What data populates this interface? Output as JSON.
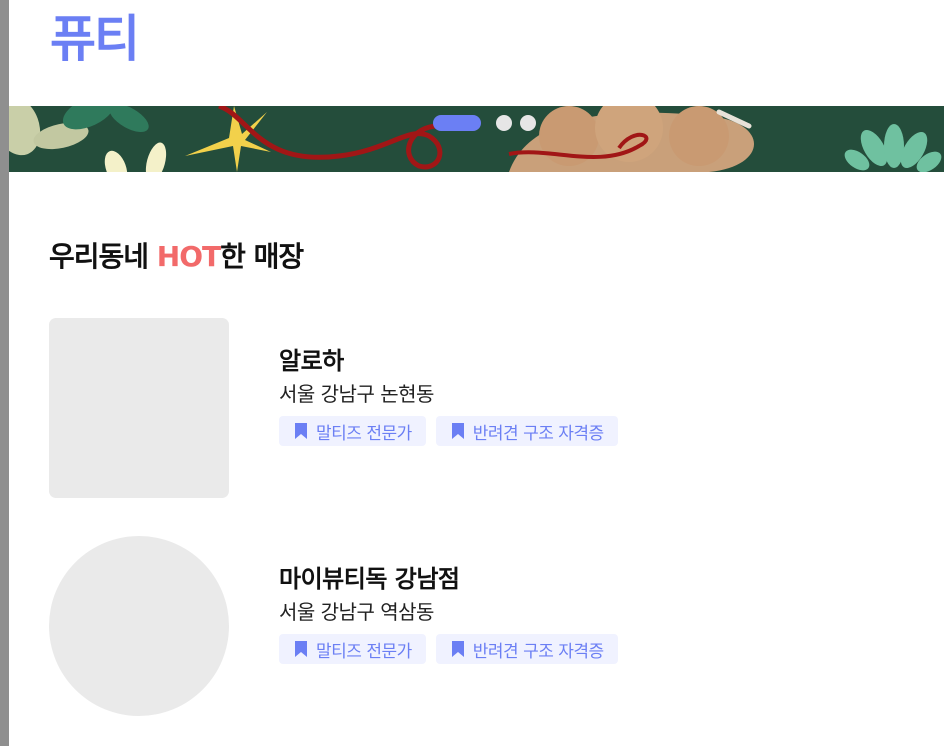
{
  "header": {
    "logo_text": "퓨티"
  },
  "banner": {
    "slides_total": 3,
    "active_slide": 1
  },
  "hot_section": {
    "title_prefix": "우리동네 ",
    "title_highlight": "HOT",
    "title_suffix": "한 매장"
  },
  "stores": [
    {
      "name": "알로하",
      "address": "서울 강남구 논현동",
      "tags": [
        "말티즈 전문가",
        "반려견 구조 자격증"
      ]
    },
    {
      "name": "마이뷰티독 강남점",
      "address": "서울 강남구 역삼동",
      "tags": [
        "말티즈 전문가",
        "반려견 구조 자격증"
      ]
    }
  ],
  "colors": {
    "brand": "#6b7ff4",
    "hot": "#f26a6a",
    "tag_bg": "#f0f2ff",
    "placeholder": "#eaeaea",
    "banner_bg": "#244d3b"
  }
}
